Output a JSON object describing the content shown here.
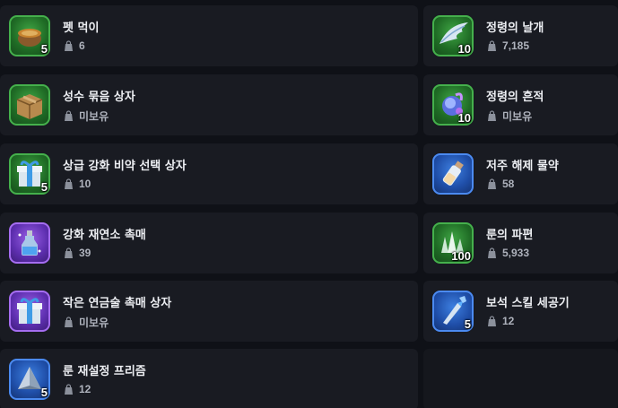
{
  "items": [
    {
      "name": "펫 먹이",
      "count": "6",
      "qty": "5",
      "frame": "green",
      "icon": "pot-icon"
    },
    {
      "name": "정령의 날개",
      "count": "7,185",
      "qty": "10",
      "frame": "green",
      "icon": "wing-icon"
    },
    {
      "name": "성수 묶음 상자",
      "count": "미보유",
      "qty": "",
      "frame": "green",
      "icon": "crate-icon"
    },
    {
      "name": "정령의 흔적",
      "count": "미보유",
      "qty": "10",
      "frame": "green",
      "icon": "spirit-orb-icon"
    },
    {
      "name": "상급 강화 비약 선택 상자",
      "count": "10",
      "qty": "5",
      "frame": "green",
      "icon": "gift-box-icon"
    },
    {
      "name": "저주 해제 물약",
      "count": "58",
      "qty": "",
      "frame": "blue",
      "icon": "potion-bottle-icon"
    },
    {
      "name": "강화 재연소 촉매",
      "count": "39",
      "qty": "",
      "frame": "purple",
      "icon": "catalyst-bottle-icon"
    },
    {
      "name": "룬의 파편",
      "count": "5,933",
      "qty": "100",
      "frame": "green",
      "icon": "rune-shard-icon"
    },
    {
      "name": "작은 연금술 촉매 상자",
      "count": "미보유",
      "qty": "",
      "frame": "purple",
      "icon": "gift-box-icon"
    },
    {
      "name": "보석 스킬 세공기",
      "count": "12",
      "qty": "5",
      "frame": "blue",
      "icon": "gem-tool-icon"
    },
    {
      "name": "룬 재설정 프리즘",
      "count": "12",
      "qty": "5",
      "frame": "blue",
      "icon": "prism-icon"
    }
  ],
  "colors": {
    "green": "#2f8f36",
    "blue": "#2a63c9",
    "purple": "#7a44cf"
  }
}
